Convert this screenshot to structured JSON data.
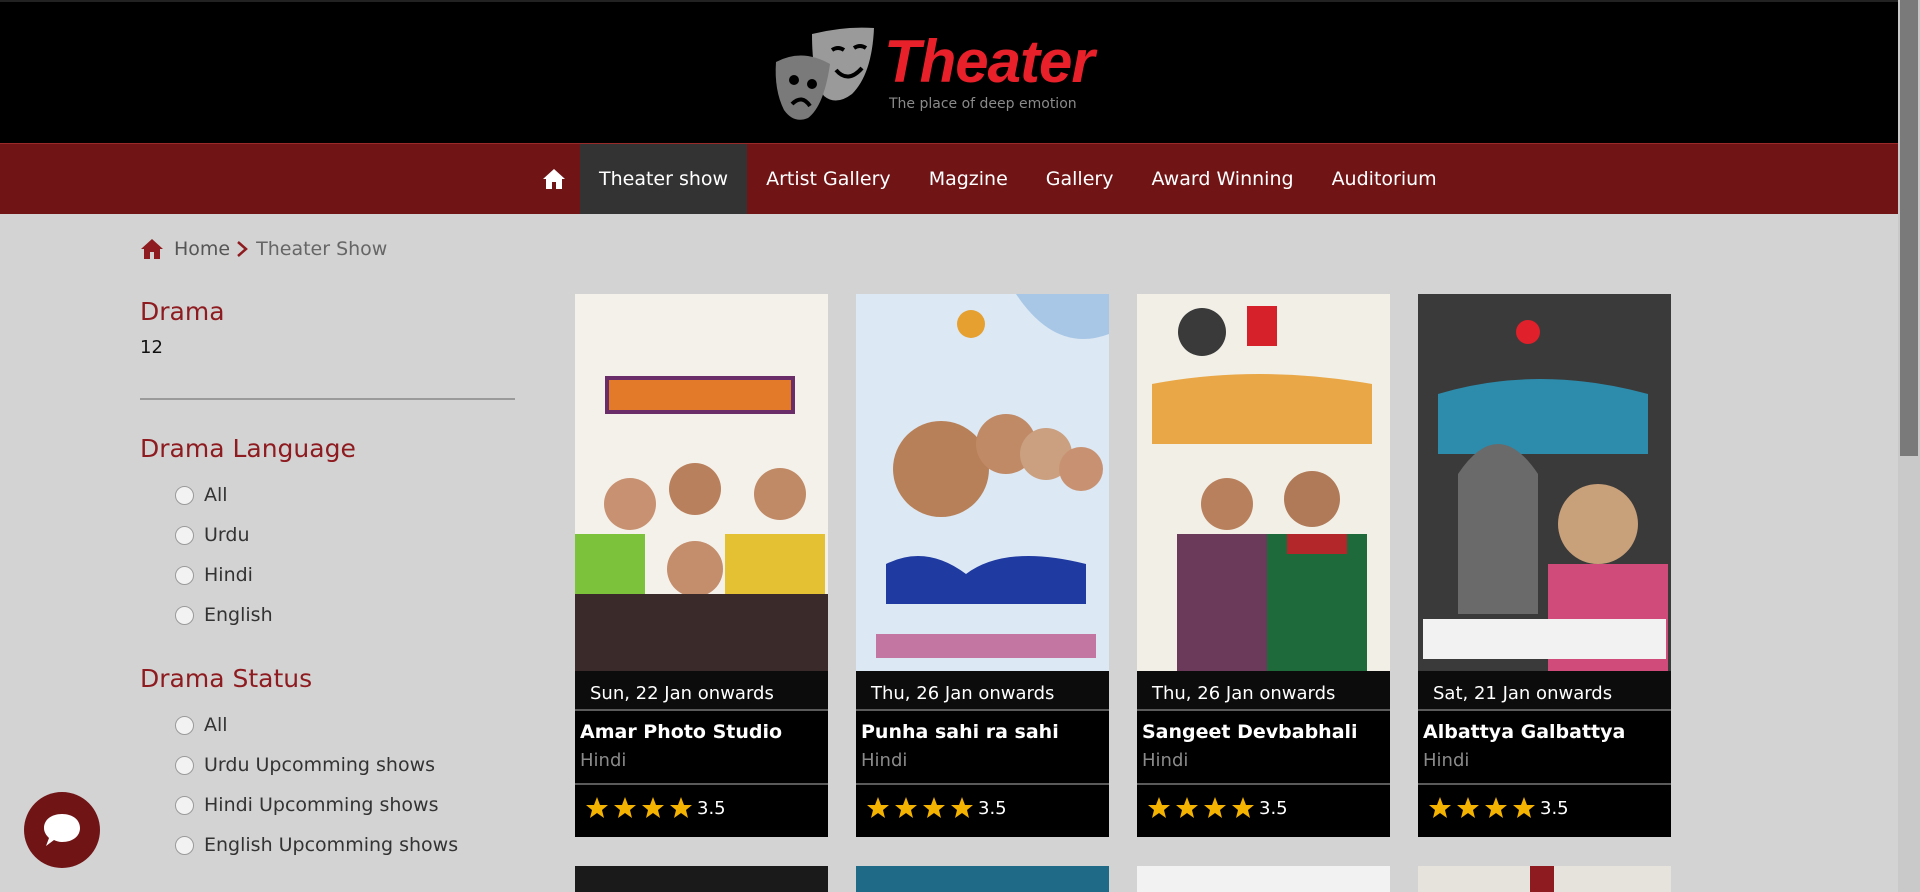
{
  "header": {
    "logo_title": "Theater",
    "logo_tagline": "The place of deep emotion"
  },
  "nav": {
    "items": [
      {
        "label": "Theater show",
        "active": true
      },
      {
        "label": "Artist Gallery"
      },
      {
        "label": "Magzine"
      },
      {
        "label": "Gallery"
      },
      {
        "label": "Award Winning"
      },
      {
        "label": "Auditorium"
      }
    ]
  },
  "breadcrumb": {
    "home": "Home",
    "current": "Theater Show"
  },
  "sidebar": {
    "drama_title": "Drama",
    "drama_count": "12",
    "language_title": "Drama Language",
    "language_options": [
      "All",
      "Urdu",
      "Hindi",
      "English"
    ],
    "status_title": "Drama Status",
    "status_options": [
      "All",
      "Urdu Upcomming shows",
      "Hindi Upcomming shows",
      "English Upcomming shows"
    ]
  },
  "shows": [
    {
      "date": "Sun, 22 Jan onwards",
      "name": "Amar Photo Studio",
      "language": "Hindi",
      "rating": "3.5",
      "stars": 4,
      "poster_color": "#f4f1ea"
    },
    {
      "date": "Thu, 26 Jan onwards",
      "name": "Punha sahi ra sahi",
      "language": "Hindi",
      "rating": "3.5",
      "stars": 4,
      "poster_color": "#dce8f4"
    },
    {
      "date": "Thu, 26 Jan onwards",
      "name": "Sangeet Devbabhali",
      "language": "Hindi",
      "rating": "3.5",
      "stars": 4,
      "poster_color": "#f1efe6"
    },
    {
      "date": "Sat, 21 Jan onwards",
      "name": "Albattya Galbattya",
      "language": "Hindi",
      "rating": "3.5",
      "stars": 4,
      "poster_color": "#2c2c2c"
    }
  ],
  "colors": {
    "brand_red": "#e8202a",
    "nav_bg": "#701416",
    "heading": "#8e1b1f",
    "star": "#f5b301"
  }
}
